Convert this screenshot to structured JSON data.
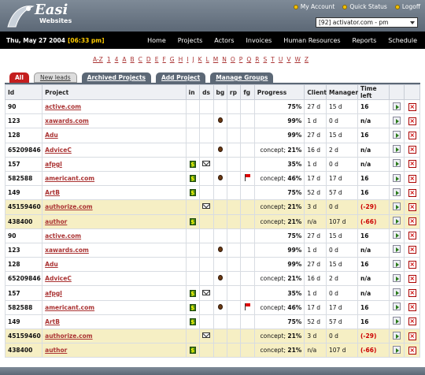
{
  "app": {
    "logo_main": "Easi",
    "logo_sub": "Websites"
  },
  "top_links": [
    "My Account",
    "Quick Status",
    "Logoff"
  ],
  "project_selector": {
    "value": "[92] activator.com - pm"
  },
  "datebar": {
    "date": "Thu, May 27 2004",
    "time": "[06:33 pm]"
  },
  "nav": [
    "Home",
    "Projects",
    "Actors",
    "Invoices",
    "Human Resources",
    "Reports",
    "Schedule"
  ],
  "alpha": [
    "A-Z",
    "1",
    "4",
    "A",
    "B",
    "C",
    "D",
    "E",
    "F",
    "G",
    "H",
    "I",
    "J",
    "K",
    "L",
    "M",
    "N",
    "O",
    "P",
    "Q",
    "R",
    "S",
    "T",
    "U",
    "V",
    "W",
    "Z"
  ],
  "tabs": {
    "all": "All",
    "new_leads": "New leads",
    "archived": "Archived Projects",
    "add": "Add Project",
    "manage": "Manage Groups"
  },
  "columns": [
    "Id",
    "Project",
    "in",
    "ds",
    "bg",
    "rp",
    "fg",
    "Progress",
    "Client",
    "Manager",
    "Time left"
  ],
  "colors": {
    "accent": "#c41e1e",
    "header_bg": "#6a7684",
    "highlight_row": "#f6efc4",
    "link": "#a33333"
  },
  "rows": [
    {
      "id": "90",
      "project": "active.com",
      "in": false,
      "ds": false,
      "bg": false,
      "fg": false,
      "concept": "",
      "pct": "75%",
      "client": "27 d",
      "manager": "15 d",
      "time_left": "16",
      "neg": false,
      "hl": false
    },
    {
      "id": "123",
      "project": "xawards.com",
      "in": false,
      "ds": false,
      "bg": true,
      "fg": false,
      "concept": "",
      "pct": "99%",
      "client": "1 d",
      "manager": "0 d",
      "time_left": "n/a",
      "neg": false,
      "hl": false
    },
    {
      "id": "128",
      "project": "Adu",
      "in": false,
      "ds": false,
      "bg": false,
      "fg": false,
      "concept": "",
      "pct": "99%",
      "client": "27 d",
      "manager": "15 d",
      "time_left": "16",
      "neg": false,
      "hl": false
    },
    {
      "id": "65209846",
      "project": "AdviceC",
      "in": false,
      "ds": false,
      "bg": true,
      "fg": false,
      "concept": "concept;",
      "pct": "21%",
      "client": "16 d",
      "manager": "2 d",
      "time_left": "n/a",
      "neg": false,
      "hl": false
    },
    {
      "id": "157",
      "project": "afpgl",
      "in": true,
      "ds": true,
      "bg": false,
      "fg": false,
      "concept": "",
      "pct": "35%",
      "client": "1 d",
      "manager": "0 d",
      "time_left": "n/a",
      "neg": false,
      "hl": false
    },
    {
      "id": "582588",
      "project": "americant.com",
      "in": true,
      "ds": false,
      "bg": true,
      "fg": true,
      "concept": "concept;",
      "pct": "46%",
      "client": "17 d",
      "manager": "17 d",
      "time_left": "16",
      "neg": false,
      "hl": false
    },
    {
      "id": "149",
      "project": "ArtB",
      "in": true,
      "ds": false,
      "bg": false,
      "fg": false,
      "concept": "",
      "pct": "75%",
      "client": "52 d",
      "manager": "57 d",
      "time_left": "16",
      "neg": false,
      "hl": false
    },
    {
      "id": "45159460",
      "project": "authorize.com",
      "in": false,
      "ds": true,
      "bg": false,
      "fg": false,
      "concept": "concept;",
      "pct": "21%",
      "client": "3 d",
      "manager": "0 d",
      "time_left": "(-29)",
      "neg": true,
      "hl": true
    },
    {
      "id": "438400",
      "project": "author",
      "in": true,
      "ds": false,
      "bg": false,
      "fg": false,
      "concept": "concept;",
      "pct": "21%",
      "client": "n/a",
      "manager": "107 d",
      "time_left": "(-66)",
      "neg": true,
      "hl": true
    },
    {
      "id": "90",
      "project": "active.com",
      "in": false,
      "ds": false,
      "bg": false,
      "fg": false,
      "concept": "",
      "pct": "75%",
      "client": "27 d",
      "manager": "15 d",
      "time_left": "16",
      "neg": false,
      "hl": false
    },
    {
      "id": "123",
      "project": "xawards.com",
      "in": false,
      "ds": false,
      "bg": true,
      "fg": false,
      "concept": "",
      "pct": "99%",
      "client": "1 d",
      "manager": "0 d",
      "time_left": "n/a",
      "neg": false,
      "hl": false
    },
    {
      "id": "128",
      "project": "Adu",
      "in": false,
      "ds": false,
      "bg": false,
      "fg": false,
      "concept": "",
      "pct": "99%",
      "client": "27 d",
      "manager": "15 d",
      "time_left": "16",
      "neg": false,
      "hl": false
    },
    {
      "id": "65209846",
      "project": "AdviceC",
      "in": false,
      "ds": false,
      "bg": true,
      "fg": false,
      "concept": "concept;",
      "pct": "21%",
      "client": "16 d",
      "manager": "2 d",
      "time_left": "n/a",
      "neg": false,
      "hl": false
    },
    {
      "id": "157",
      "project": "afpgl",
      "in": true,
      "ds": true,
      "bg": false,
      "fg": false,
      "concept": "",
      "pct": "35%",
      "client": "1 d",
      "manager": "0 d",
      "time_left": "n/a",
      "neg": false,
      "hl": false
    },
    {
      "id": "582588",
      "project": "americant.com",
      "in": true,
      "ds": false,
      "bg": true,
      "fg": true,
      "concept": "concept;",
      "pct": "46%",
      "client": "17 d",
      "manager": "17 d",
      "time_left": "16",
      "neg": false,
      "hl": false
    },
    {
      "id": "149",
      "project": "ArtB",
      "in": true,
      "ds": false,
      "bg": false,
      "fg": false,
      "concept": "",
      "pct": "75%",
      "client": "52 d",
      "manager": "57 d",
      "time_left": "16",
      "neg": false,
      "hl": false
    },
    {
      "id": "45159460",
      "project": "authorize.com",
      "in": false,
      "ds": true,
      "bg": false,
      "fg": false,
      "concept": "concept;",
      "pct": "21%",
      "client": "3 d",
      "manager": "0 d",
      "time_left": "(-29)",
      "neg": true,
      "hl": true
    },
    {
      "id": "438400",
      "project": "author",
      "in": true,
      "ds": false,
      "bg": false,
      "fg": false,
      "concept": "concept;",
      "pct": "21%",
      "client": "n/a",
      "manager": "107 d",
      "time_left": "(-66)",
      "neg": true,
      "hl": true
    }
  ]
}
